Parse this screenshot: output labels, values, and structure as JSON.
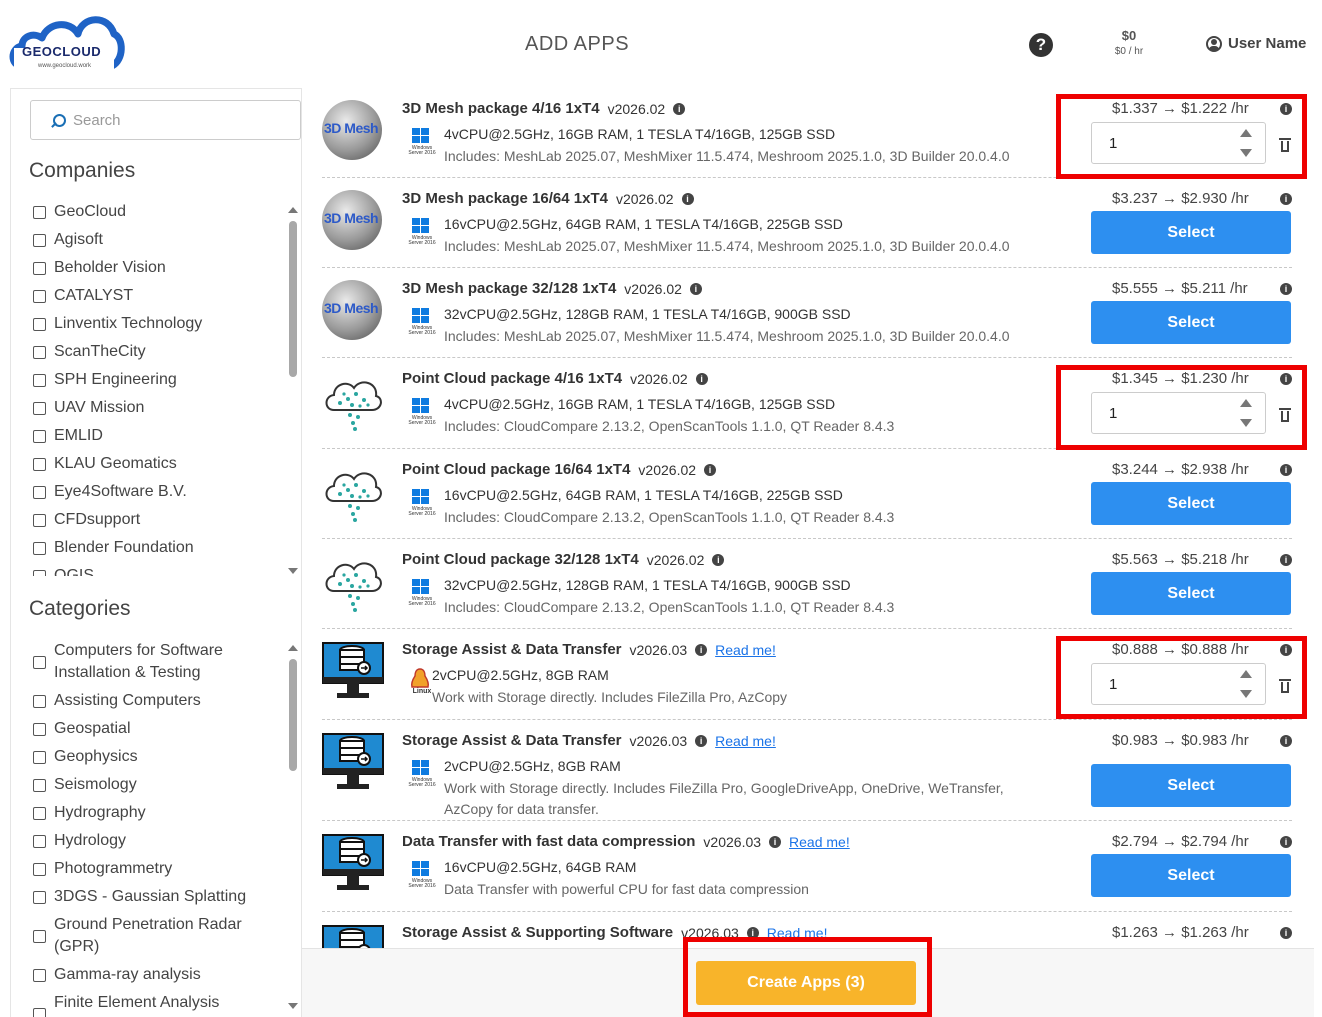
{
  "header": {
    "logo_text": "GEOCLOUD",
    "logo_sub": "www.geocloud.work",
    "title": "ADD APPS",
    "help_glyph": "?",
    "balance": "$0",
    "balance_rate": "$0 / hr",
    "user_name": "User Name"
  },
  "sidebar": {
    "search_placeholder": "Search",
    "companies_title": "Companies",
    "companies": [
      "GeoCloud",
      "Agisoft",
      "Beholder Vision",
      "CATALYST",
      "Linventix Technology",
      "ScanTheCity",
      "SPH Engineering",
      "UAV Mission",
      "EMLID",
      "KLAU Geomatics",
      "Eye4Software B.V.",
      "CFDsupport",
      "Blender Foundation",
      "QGIS"
    ],
    "categories_title": "Categories",
    "categories": [
      "Computers for Software Installation & Testing",
      "Assisting Computers",
      "Geospatial",
      "Geophysics",
      "Seismology",
      "Hydrography",
      "Hydrology",
      "Photogrammetry",
      "3DGS - Gaussian Splatting",
      "Ground Penetration Radar (GPR)",
      "Gamma-ray analysis",
      "Finite Element Analysis (FEA)"
    ]
  },
  "icon_texts": {
    "mesh": "3D Mesh",
    "os_windows": "Windows Server 2016",
    "os_linux": "Linux"
  },
  "packages": [
    {
      "name": "3D Mesh package 4/16 1xT4",
      "version": "v2026.02",
      "spec": "4vCPU@2.5GHz, 16GB RAM, 1 TESLA T4/16GB, 125GB SSD",
      "includes": "Includes: MeshLab 2025.07, MeshMixer 11.5.474, Meshroom 2025.1.0, 3D Builder 20.0.4.0",
      "price": "$1.337 → $1.222 /hr",
      "qty": "1",
      "icon": "mesh-sphere-icon",
      "os": "windows-icon"
    },
    {
      "name": "3D Mesh package 16/64 1xT4",
      "version": "v2026.02",
      "spec": "16vCPU@2.5GHz, 64GB RAM, 1 TESLA T4/16GB, 225GB SSD",
      "includes": "Includes: MeshLab 2025.07, MeshMixer 11.5.474, Meshroom 2025.1.0, 3D Builder 20.0.4.0",
      "price": "$3.237 → $2.930 /hr",
      "button": "Select",
      "icon": "mesh-sphere-icon",
      "os": "windows-icon"
    },
    {
      "name": "3D Mesh package 32/128 1xT4",
      "version": "v2026.02",
      "spec": "32vCPU@2.5GHz, 128GB RAM, 1 TESLA T4/16GB, 900GB SSD",
      "includes": "Includes: MeshLab 2025.07, MeshMixer 11.5.474, Meshroom 2025.1.0, 3D Builder 20.0.4.0",
      "price": "$5.555 → $5.211 /hr",
      "button": "Select",
      "icon": "mesh-sphere-icon",
      "os": "windows-icon"
    },
    {
      "name": "Point Cloud package 4/16 1xT4",
      "version": "v2026.02",
      "spec": "4vCPU@2.5GHz, 16GB RAM, 1 TESLA T4/16GB, 125GB SSD",
      "includes": "Includes: CloudCompare 2.13.2, OpenScanTools 1.1.0, QT Reader 8.4.3",
      "price": "$1.345 → $1.230 /hr",
      "qty": "1",
      "icon": "point-cloud-icon",
      "os": "windows-icon"
    },
    {
      "name": "Point Cloud package 16/64 1xT4",
      "version": "v2026.02",
      "spec": "16vCPU@2.5GHz, 64GB RAM, 1 TESLA T4/16GB, 225GB SSD",
      "includes": "Includes: CloudCompare 2.13.2, OpenScanTools 1.1.0, QT Reader 8.4.3",
      "price": "$3.244 → $2.938 /hr",
      "button": "Select",
      "icon": "point-cloud-icon",
      "os": "windows-icon"
    },
    {
      "name": "Point Cloud package 32/128 1xT4",
      "version": "v2026.02",
      "spec": "32vCPU@2.5GHz, 128GB RAM, 1 TESLA T4/16GB, 900GB SSD",
      "includes": "Includes: CloudCompare 2.13.2, OpenScanTools 1.1.0, QT Reader 8.4.3",
      "price": "$5.563 → $5.218 /hr",
      "button": "Select",
      "icon": "point-cloud-icon",
      "os": "windows-icon"
    },
    {
      "name": "Storage Assist & Data Transfer",
      "version": "v2026.03",
      "readme": "Read me!",
      "spec": "2vCPU@2.5GHz, 8GB RAM",
      "includes": "Work with Storage directly. Includes FileZilla Pro, AzCopy",
      "price": "$0.888 → $0.888 /hr",
      "qty": "1",
      "icon": "storage-monitor-icon",
      "os": "linux-icon"
    },
    {
      "name": "Storage Assist & Data Transfer",
      "version": "v2026.03",
      "readme": "Read me!",
      "spec": "2vCPU@2.5GHz, 8GB RAM",
      "includes": "Work with Storage directly. Includes FileZilla Pro, GoogleDriveApp, OneDrive, WeTransfer, AzCopy for data transfer.",
      "price": "$0.983 → $0.983 /hr",
      "button": "Select",
      "icon": "storage-monitor-icon",
      "os": "windows-icon"
    },
    {
      "name": "Data Transfer with fast data compression",
      "version": "v2026.03",
      "readme": "Read me!",
      "spec": "16vCPU@2.5GHz, 64GB RAM",
      "includes": "Data Transfer with powerful CPU for fast data compression",
      "price": "$2.794 → $2.794 /hr",
      "button": "Select",
      "icon": "storage-monitor-icon",
      "os": "windows-icon"
    },
    {
      "name": "Storage Assist & Supporting Software",
      "version": "v2026.03",
      "readme": "Read me!",
      "price": "$1.263 → $1.263 /hr",
      "icon": "storage-monitor-icon"
    }
  ],
  "footer": {
    "create_button": "Create Apps (3)"
  },
  "colors": {
    "primary_button": "#2d8ff0",
    "create_button": "#f8b42a",
    "highlight": "#ee0000"
  }
}
